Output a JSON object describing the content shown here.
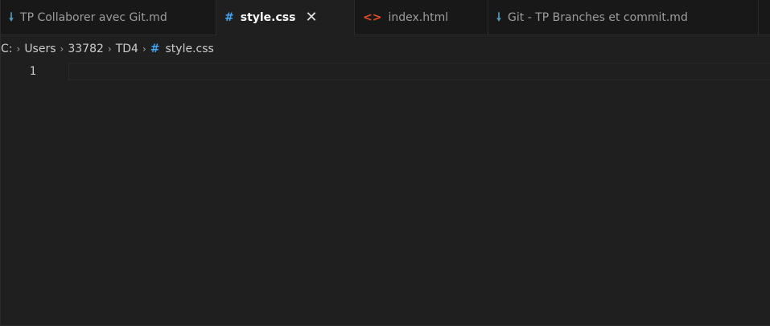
{
  "tabs": [
    {
      "label": "TP Collaborer avec Git.md",
      "icon": "markdown-icon",
      "glyph": "🠗",
      "active": false
    },
    {
      "label": "style.css",
      "icon": "css-hash-icon",
      "glyph": "#",
      "active": true,
      "close": "✕"
    },
    {
      "label": "index.html",
      "icon": "html-brackets-icon",
      "glyph": "<>",
      "active": false
    },
    {
      "label": "Git  - TP Branches et commit.md",
      "icon": "markdown-icon",
      "glyph": "🠗",
      "active": false
    }
  ],
  "breadcrumb": {
    "items": [
      "C:",
      "Users",
      "33782",
      "TD4",
      "style.css"
    ],
    "separator": "›",
    "file_icon": "#"
  },
  "editor": {
    "line_numbers": [
      "1"
    ],
    "content": ""
  },
  "colors": {
    "background": "#1f1f1f",
    "tabbar": "#181818",
    "css_icon": "#42a5f5",
    "md_icon": "#519aba",
    "html_icon": "#e44d26"
  }
}
